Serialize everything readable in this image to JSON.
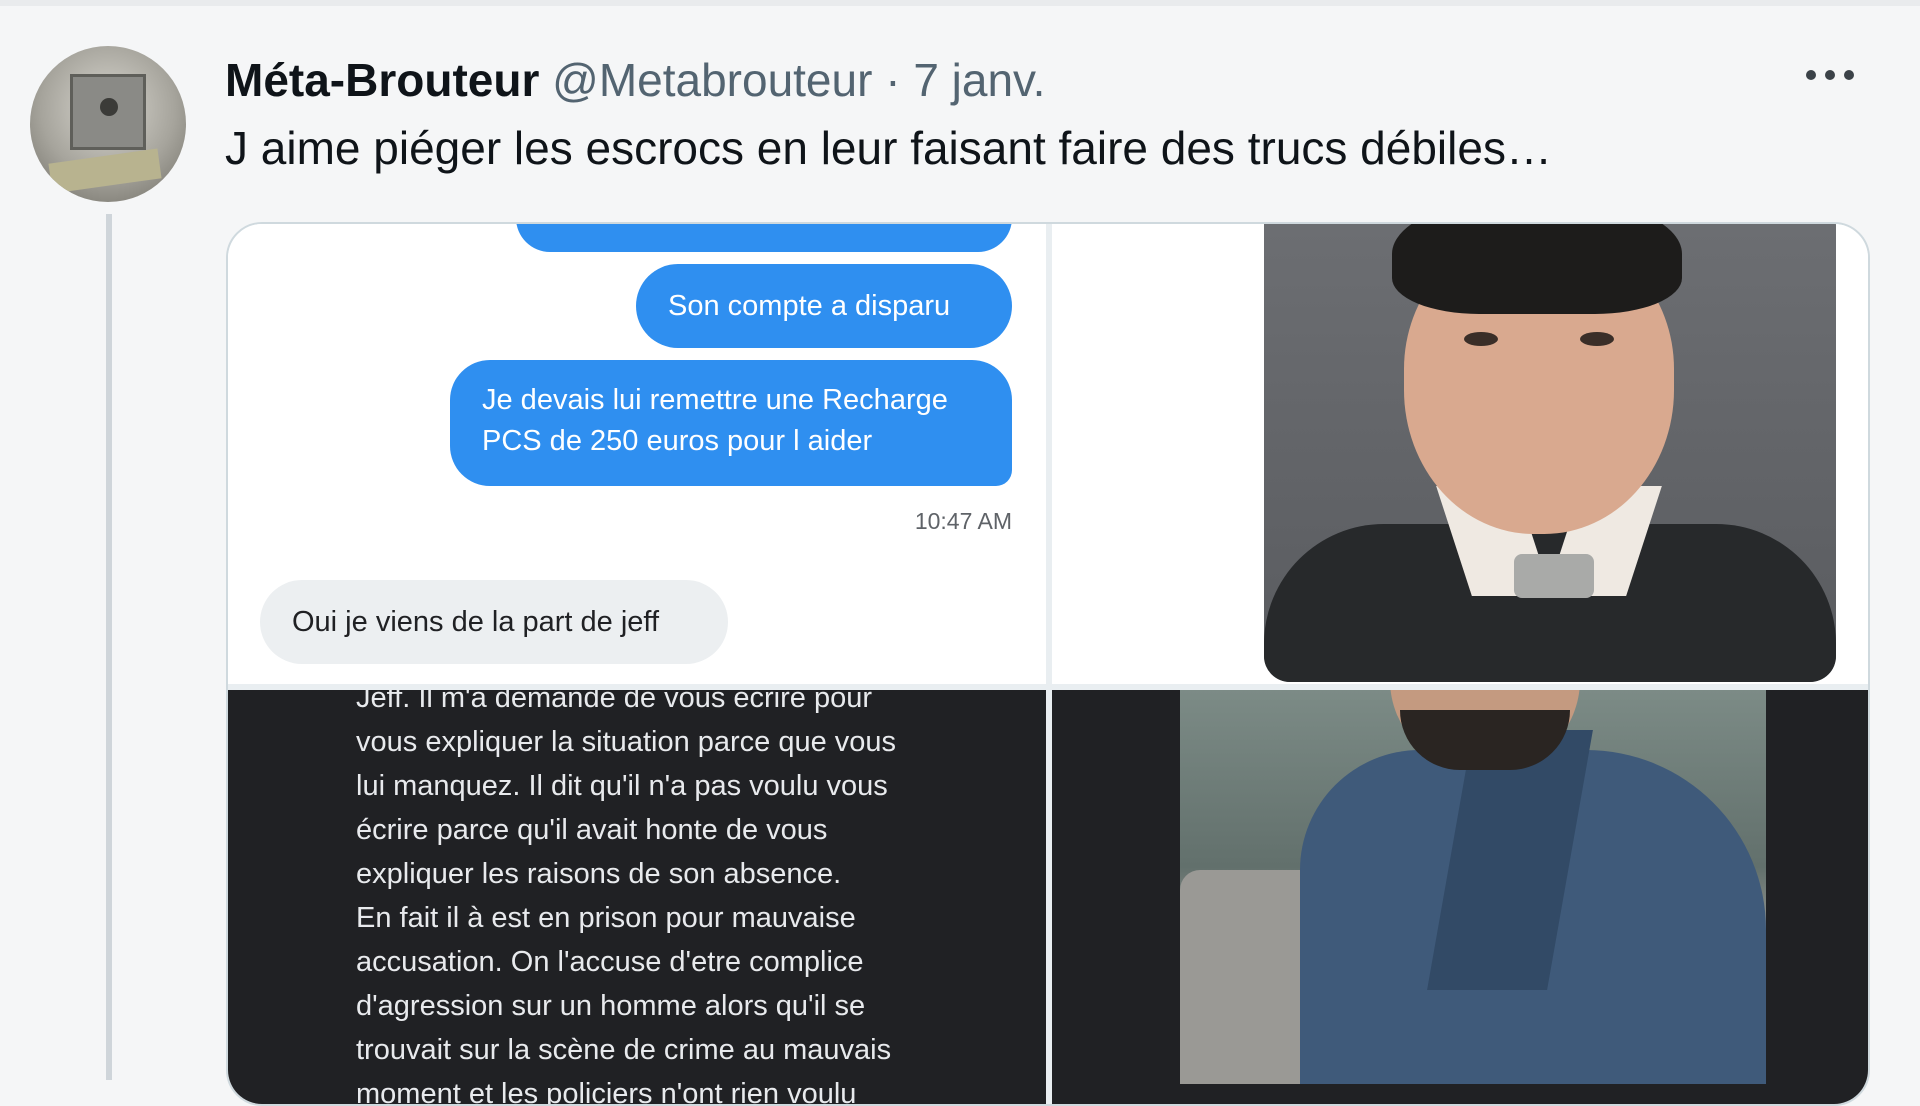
{
  "tweet": {
    "author_name": "Méta-Brouteur",
    "handle": "@Metabrouteur",
    "separator": "·",
    "date": "7 janv.",
    "text": "J aime piéger les escrocs en leur faisant faire des trucs débiles…",
    "more_icon": "more-horizontal-icon"
  },
  "media": {
    "chat": {
      "outgoing": [
        "Son compte a disparu",
        "Je devais lui remettre une Recharge PCS de 250 euros pour l aider"
      ],
      "time": "10:47 AM",
      "incoming": "Oui je viens de la part de jeff"
    },
    "letter": {
      "lines": [
        "Jeff. Il m'a demandé de vous écrire pour",
        "vous expliquer la situation parce que vous",
        "lui manquez. Il dit qu'il n'a pas voulu vous",
        "écrire parce qu'il avait honte de vous",
        "expliquer les raisons de son absence.",
        "En fait il à est en prison pour mauvaise",
        "accusation. On l'accuse d'etre complice",
        "d'agression sur  un homme alors qu'il se",
        "trouvait sur la scène de crime au mauvais",
        "moment et les policiers n'ont rien voulu"
      ]
    }
  },
  "colors": {
    "bubble_blue": "#2f8ff0",
    "bubble_gray": "#eceff1",
    "dark_panel": "#202124",
    "muted_text": "#536471"
  }
}
